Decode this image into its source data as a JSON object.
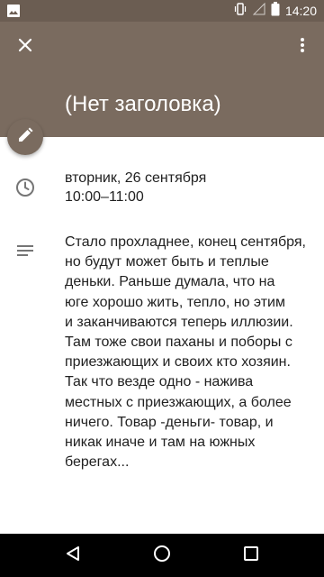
{
  "status_bar": {
    "time": "14:20",
    "icons": [
      "gallery-icon",
      "vibrate-icon",
      "signal-icon",
      "battery-icon"
    ]
  },
  "header": {
    "title": "(Нет заголовка)",
    "background_color": "#7a6b5f",
    "left_icon": "close-icon",
    "right_icon": "more-vert-icon"
  },
  "fab": {
    "icon": "edit-icon"
  },
  "event": {
    "date": "вторник, 26 сентября",
    "time_range": "10:00–11:00",
    "description": "Стало прохладнее, конец сентября,\nно будут может быть  и теплые\nденьки. Раньше думала, что на\nюге хорошо жить, тепло, но этим\nи заканчиваются теперь иллюзии.\nТам тоже свои паханы и поборы с\nприезжающих и своих кто хозяин.\nТак что везде одно - нажива\nместных с приезжающих, а более\nничего. Товар -деньги- товар, и\nникак иначе и там на южных\nберегах..."
  },
  "nav_bar": {
    "icons": [
      "back-icon",
      "home-icon",
      "recents-icon"
    ]
  }
}
